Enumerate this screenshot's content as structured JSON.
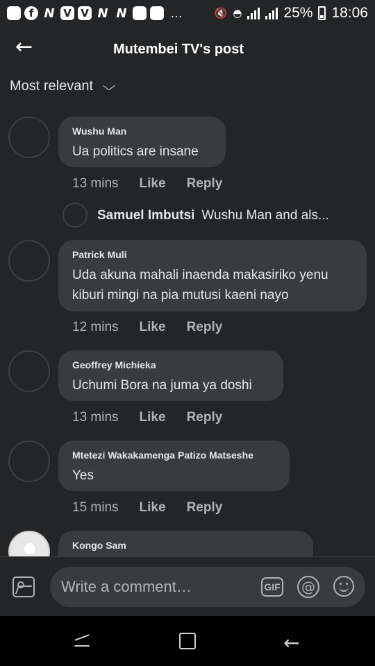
{
  "status_bar": {
    "app_icons": [
      "f",
      "N",
      "V",
      "V",
      "N",
      "N",
      "",
      ""
    ],
    "more": "…",
    "battery_percent": "25%",
    "time": "18:06"
  },
  "header": {
    "back_icon": "arrow-left-icon",
    "title": "Mutembei TV's post"
  },
  "sort": {
    "label": "Most relevant",
    "icon": "chevron-down-icon"
  },
  "comments": [
    {
      "author": "Wushu Man",
      "text": "Ua politics are insane",
      "time": "13 mins",
      "like": "Like",
      "reply": "Reply"
    },
    {
      "author": "Patrick Muli",
      "text": "Uda akuna mahali inaenda makasiriko yenu kiburi mingi na pia mutusi kaeni nayo",
      "time": "12 mins",
      "like": "Like",
      "reply": "Reply"
    },
    {
      "author": "Geoffrey Michieka",
      "text": "Uchumi Bora na juma ya doshi",
      "time": "13 mins",
      "like": "Like",
      "reply": "Reply"
    },
    {
      "author": "Mtetezi Wakakamenga Patizo Matseshe",
      "text": "Yes",
      "time": "15 mins",
      "like": "Like",
      "reply": "Reply"
    },
    {
      "author": "Kongo Sam"
    }
  ],
  "reply_preview": {
    "author": "Samuel Imbutsi",
    "snippet": "Wushu Man and als..."
  },
  "composer": {
    "placeholder": "Write a comment…",
    "gif_label": "GIF",
    "at_label": "@",
    "icons": [
      "photo-icon",
      "gif-icon",
      "mention-icon",
      "emoji-icon"
    ]
  },
  "navbar": {
    "icons": [
      "recent-apps-icon",
      "home-icon",
      "back-icon"
    ]
  }
}
